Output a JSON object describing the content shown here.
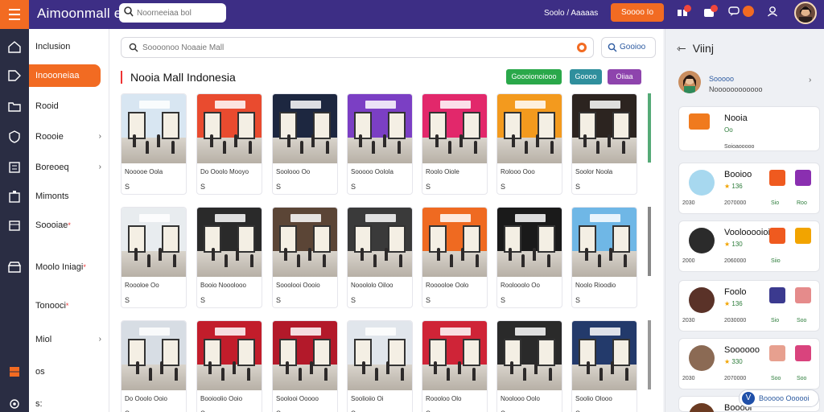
{
  "app": {
    "title": "Aimoonmall e"
  },
  "topbar": {
    "search_placeholder": "Noorneeiaa bol",
    "link": "Soolo / Aaaaas",
    "button": "Soooo Io",
    "icons": [
      "gift-icon",
      "bag-icon",
      "chat-icon",
      "notification-icon",
      "user-icon"
    ],
    "accent": "#f26b22",
    "bar_color": "#3d2e85"
  },
  "sidebar": {
    "items": [
      {
        "label": "Inclusion",
        "icon": "home-icon",
        "active": false,
        "chevron": false,
        "mark": false
      },
      {
        "label": "Inoooneiaa",
        "icon": "tag-icon",
        "active": true,
        "chevron": false,
        "mark": false
      },
      {
        "label": "Rooid",
        "icon": "folder-icon",
        "active": false,
        "chevron": false,
        "mark": false
      },
      {
        "label": "Roooie",
        "icon": "shield-icon",
        "active": false,
        "chevron": true,
        "mark": false
      },
      {
        "label": "Boreoeq",
        "icon": "list-icon",
        "active": false,
        "chevron": true,
        "mark": false
      },
      {
        "label": "Mimonts",
        "icon": "building-icon",
        "active": false,
        "chevron": false,
        "mark": false
      },
      {
        "label": "Soooiae",
        "icon": "calendar-icon",
        "active": false,
        "chevron": false,
        "mark": true
      },
      {
        "label": "Moolo Iniagi",
        "icon": "store-icon",
        "active": false,
        "chevron": false,
        "mark": true
      },
      {
        "label": "Tonooci",
        "icon": "",
        "active": false,
        "chevron": false,
        "mark": true
      },
      {
        "label": "Miol",
        "icon": "",
        "active": false,
        "chevron": true,
        "mark": false
      },
      {
        "label": "os",
        "icon": "grid-icon",
        "active": false,
        "chevron": false,
        "mark": false
      },
      {
        "label": "s:",
        "icon": "settings-icon",
        "active": false,
        "chevron": false,
        "mark": false
      }
    ]
  },
  "main": {
    "search_placeholder": "Soooonoo Noaaie Mall",
    "filter_label": "Gooioo",
    "section_title": "Nooia Mall Indonesia",
    "chips": [
      {
        "label": "Goooionoiooo",
        "color": "#2aa84a"
      },
      {
        "label": "Goooo",
        "color": "#2f8f9d"
      },
      {
        "label": "Oiiaa",
        "color": "#8e44ad"
      }
    ],
    "stores": [
      {
        "title": "Nooooe Oola",
        "price": "S",
        "accent": "#d8e6f2"
      },
      {
        "title": "Do Ooolo Mooyo",
        "price": "S",
        "accent": "#e94b2f"
      },
      {
        "title": "Soolooo Oo",
        "price": "S",
        "accent": "#1d2740"
      },
      {
        "title": "Sooooo Oolola",
        "price": "S",
        "accent": "#7b3fc4"
      },
      {
        "title": "Roolo Oiole",
        "price": "S",
        "accent": "#e2286b"
      },
      {
        "title": "Rolooo Ooo",
        "price": "S",
        "accent": "#f39a1e"
      },
      {
        "title": "Soolor Noola",
        "price": "S",
        "accent": "#2c2420"
      },
      {
        "title": "Roooloe Oo",
        "price": "S",
        "accent": "#e8ecef"
      },
      {
        "title": "Booio Nooolooo",
        "price": "S",
        "accent": "#2a2a2a"
      },
      {
        "title": "Sooolooi Oooio",
        "price": "S",
        "accent": "#5b4536"
      },
      {
        "title": "Nooololo Oiloo",
        "price": "S",
        "accent": "#3a3a3a"
      },
      {
        "title": "Rooooloe Oolo",
        "price": "S",
        "accent": "#ef6a21"
      },
      {
        "title": "Roolooolo Oo",
        "price": "S",
        "accent": "#1a1a1a"
      },
      {
        "title": "Noolo Rioodio",
        "price": "S",
        "accent": "#6fb7e6"
      },
      {
        "title": "Do Ooolo Ooio",
        "price": "S",
        "accent": "#d7dde4"
      },
      {
        "title": "Booioolio Ooio",
        "price": "S",
        "accent": "#c21d2b"
      },
      {
        "title": "Soolooi Ooooo",
        "price": "S",
        "accent": "#b3192a"
      },
      {
        "title": "Soolioiio Oi",
        "price": "S",
        "accent": "#e1e6ec"
      },
      {
        "title": "Roooloo Olo",
        "price": "S",
        "accent": "#cf2437"
      },
      {
        "title": "Noolooo Oolo",
        "price": "S",
        "accent": "#2a2a2a"
      },
      {
        "title": "Soolio Olooo",
        "price": "S",
        "accent": "#233a6b"
      }
    ]
  },
  "right_panel": {
    "title": "Viinj",
    "user": {
      "name": "Sooooo",
      "sub": "Noooooooooooo"
    },
    "cards": [
      {
        "name": "Nooia",
        "stat": "Oo",
        "meta_l": "",
        "meta_r": "Soioaooooo",
        "icons": [],
        "labels": [],
        "img_color": "#f07a1e",
        "badge": ""
      },
      {
        "name": "Booioo",
        "stat": "136",
        "meta_l": "2030",
        "meta_r": "2070000",
        "icons": [
          "#ef5a1f",
          "#8a2fb0"
        ],
        "labels": [
          "Sio",
          "Roo"
        ],
        "img_color": "#a7d8ef",
        "badge": ""
      },
      {
        "name": "Voolooooioio",
        "stat": "130",
        "meta_l": "2000",
        "meta_r": "2060000",
        "icons": [
          "#ef5a1f",
          "#f2a400"
        ],
        "labels": [
          "Siio",
          ""
        ],
        "img_color": "#2b2b2b",
        "badge": ""
      },
      {
        "name": "Foolo",
        "stat": "136",
        "meta_l": "2030",
        "meta_r": "2030000",
        "icons": [
          "#3b3a8f",
          "#e58b8b"
        ],
        "labels": [
          "Sio",
          "Soo"
        ],
        "img_color": "#5a3228",
        "badge": ""
      },
      {
        "name": "Soooooo",
        "stat": "330",
        "meta_l": "2030",
        "meta_r": "2070000",
        "icons": [
          "#e7a08f",
          "#d9437d"
        ],
        "labels": [
          "Soo",
          "Soo"
        ],
        "img_color": "#8b6a54",
        "badge": ""
      },
      {
        "name": "Booool",
        "stat": "",
        "meta_l": "",
        "meta_r": "",
        "icons": [],
        "labels": [],
        "img_color": "#6b3b22",
        "badge": ""
      }
    ],
    "help_label": "Booooo Oooooi"
  }
}
